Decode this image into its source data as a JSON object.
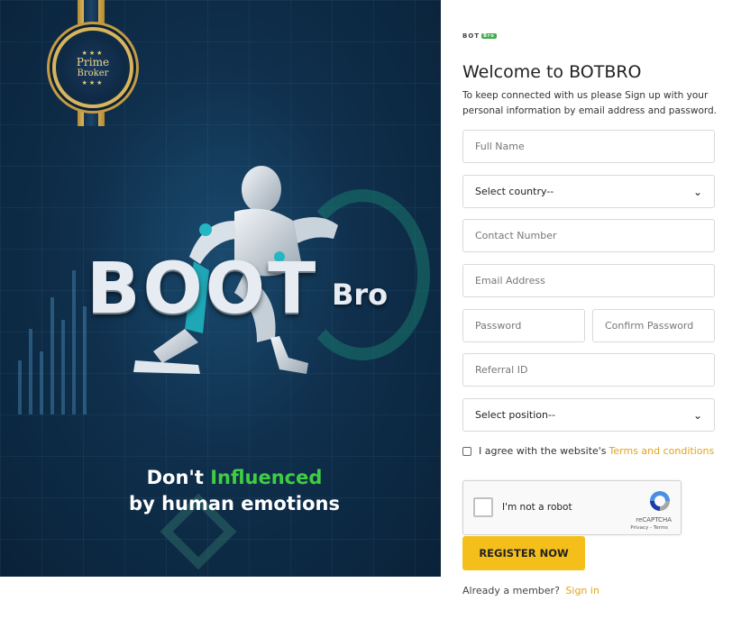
{
  "banner": {
    "medal": {
      "line1": "Prime",
      "line2": "Broker",
      "stars": "★★★"
    },
    "logo_main": "BOOT",
    "logo_sub": "Bro",
    "tagline_pre": "Don't",
    "tagline_highlight": "Influenced",
    "tagline_line2": "by human emotions"
  },
  "form": {
    "mini_logo": "BOT",
    "mini_logo_pill": "Bro",
    "title": "Welcome to BOTBRO",
    "intro": "To keep connected with us please Sign up with your personal information by email address and password.",
    "full_name_placeholder": "Full Name",
    "country_value": "Select country--",
    "contact_placeholder": "Contact Number",
    "email_placeholder": "Email Address",
    "password_placeholder": "Password",
    "confirm_password_placeholder": "Confirm Password",
    "referral_placeholder": "Referral ID",
    "position_value": "Select position--",
    "agree_text": "I agree with the website's",
    "terms_link": "Terms and conditions",
    "captcha_text": "I'm not a robot",
    "captcha_brand": "reCAPTCHA",
    "captcha_terms": "Privacy - Terms",
    "register_label": "REGISTER NOW",
    "member_text": "Already a member?",
    "signin_link": "Sign in"
  },
  "colors": {
    "accent": "#f5bf1b",
    "link": "#e0a31a",
    "banner_bg": "#0f2f4c",
    "highlight_green": "#3fce43"
  }
}
